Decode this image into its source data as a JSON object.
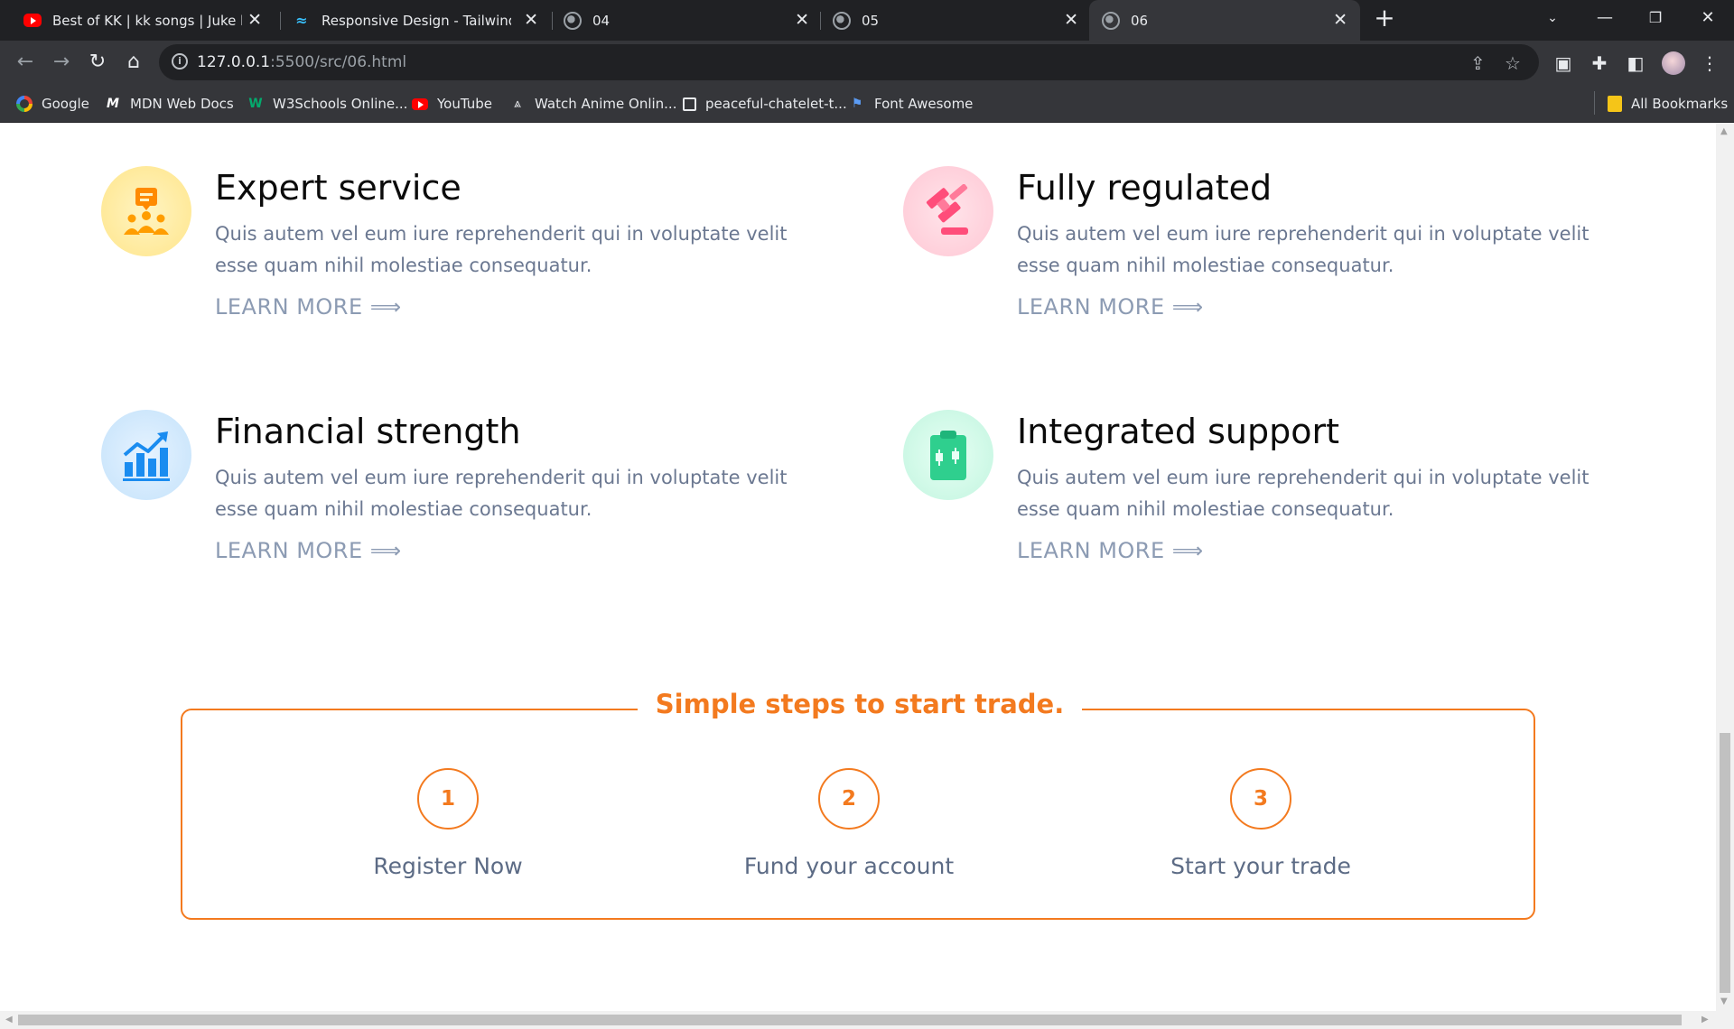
{
  "browser": {
    "tabs": [
      {
        "title": "Best of KK | kk songs | Juke box |",
        "favicon": "youtube-icon"
      },
      {
        "title": "Responsive Design - Tailwind CSS",
        "favicon": "tailwind-icon"
      },
      {
        "title": "04",
        "favicon": "globe-icon"
      },
      {
        "title": "05",
        "favicon": "globe-icon"
      },
      {
        "title": "06",
        "favicon": "globe-icon"
      }
    ],
    "url_host": "127.0.0.1",
    "url_rest": ":5500/src/06.html",
    "bookmarks": [
      {
        "label": "Google",
        "icon": "google-icon"
      },
      {
        "label": "MDN Web Docs",
        "icon": "mdn-icon"
      },
      {
        "label": "W3Schools Online...",
        "icon": "w3schools-icon"
      },
      {
        "label": "YouTube",
        "icon": "youtube-icon"
      },
      {
        "label": "Watch Anime Onlin...",
        "icon": "anime-icon"
      },
      {
        "label": "peaceful-chatelet-t...",
        "icon": "page-icon"
      },
      {
        "label": "Font Awesome",
        "icon": "flag-icon"
      }
    ],
    "all_bookmarks": "All Bookmarks"
  },
  "features": [
    {
      "title": "Expert service",
      "desc": "Quis autem vel eum iure reprehenderit qui in voluptate velit esse quam nihil molestiae consequatur.",
      "link": "LEARN MORE ⟹",
      "icon": "support-team-icon"
    },
    {
      "title": "Fully regulated",
      "desc": "Quis autem vel eum iure reprehenderit qui in voluptate velit esse quam nihil molestiae consequatur.",
      "link": "LEARN MORE ⟹",
      "icon": "gavel-icon"
    },
    {
      "title": "Financial strength",
      "desc": "Quis autem vel eum iure reprehenderit qui in voluptate velit esse quam nihil molestiae consequatur.",
      "link": "LEARN MORE ⟹",
      "icon": "growth-chart-icon"
    },
    {
      "title": "Integrated support",
      "desc": "Quis autem vel eum iure reprehenderit qui in voluptate velit esse quam nihil molestiae consequatur.",
      "link": "LEARN MORE ⟹",
      "icon": "clipboard-chart-icon"
    }
  ],
  "steps": {
    "title": "Simple steps to start trade.",
    "items": [
      {
        "num": "1",
        "label": "Register Now"
      },
      {
        "num": "2",
        "label": "Fund your account"
      },
      {
        "num": "3",
        "label": "Start your trade"
      }
    ]
  },
  "colors": {
    "accent": "#f37a1f",
    "text_muted": "#6b7891",
    "link": "#8c9bb3"
  }
}
